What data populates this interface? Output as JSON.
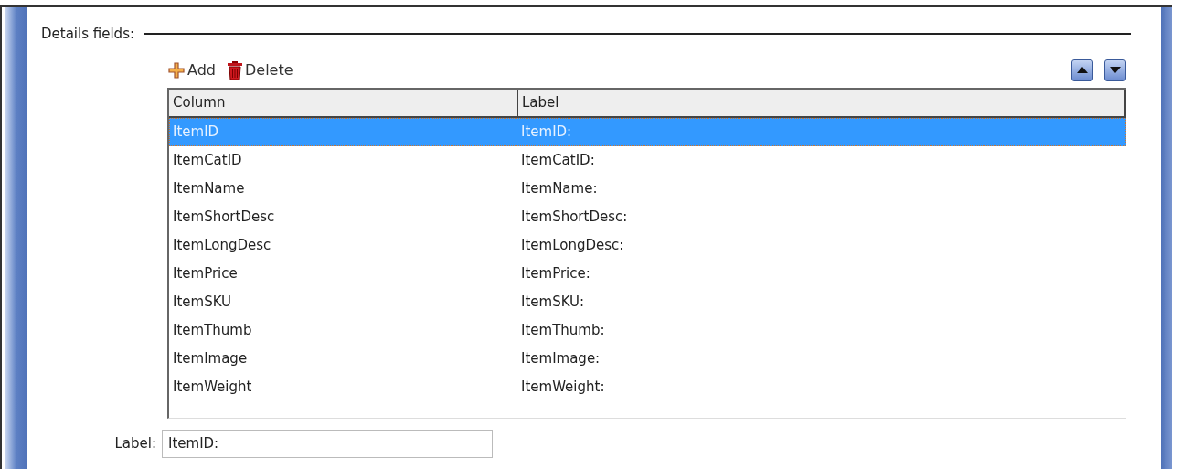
{
  "section": {
    "title": "Details fields:"
  },
  "toolbar": {
    "buttons": [
      {
        "kind": "add",
        "label": "Add"
      },
      {
        "kind": "delete",
        "label": "Delete"
      }
    ],
    "move_buttons": [
      {
        "kind": "up"
      },
      {
        "kind": "down"
      }
    ]
  },
  "table": {
    "columns": [
      "Column",
      "Label"
    ],
    "rows": [
      {
        "cells": [
          "ItemID",
          "ItemID:"
        ],
        "selected": true
      },
      {
        "cells": [
          "ItemCatID",
          "ItemCatID:"
        ],
        "selected": false
      },
      {
        "cells": [
          "ItemName",
          "ItemName:"
        ],
        "selected": false
      },
      {
        "cells": [
          "ItemShortDesc",
          "ItemShortDesc:"
        ],
        "selected": false
      },
      {
        "cells": [
          "ItemLongDesc",
          "ItemLongDesc:"
        ],
        "selected": false
      },
      {
        "cells": [
          "ItemPrice",
          "ItemPrice:"
        ],
        "selected": false
      },
      {
        "cells": [
          "ItemSKU",
          "ItemSKU:"
        ],
        "selected": false
      },
      {
        "cells": [
          "ItemThumb",
          "ItemThumb:"
        ],
        "selected": false
      },
      {
        "cells": [
          "ItemImage",
          "ItemImage:"
        ],
        "selected": false
      },
      {
        "cells": [
          "ItemWeight",
          "ItemWeight:"
        ],
        "selected": false
      }
    ]
  },
  "label_field": {
    "label": "Label:",
    "value": "ItemID:"
  }
}
